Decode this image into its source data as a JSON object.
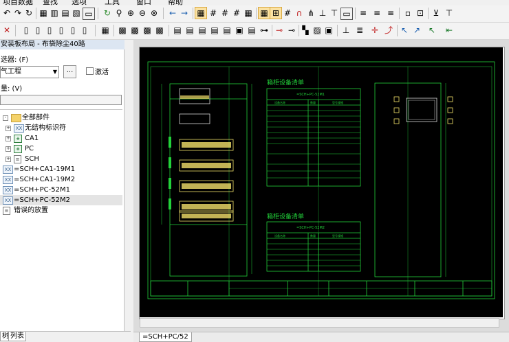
{
  "menu": [
    "项目数据",
    "查找",
    "选项",
    "工具",
    "窗口",
    "帮助"
  ],
  "toolbar1": [
    "undo-icon",
    "redo-icon",
    "refresh-icon",
    "view-1-icon",
    "view-2-icon",
    "view-3-icon",
    "view-4-icon",
    "window-icon",
    "rotate-icon",
    "zoom-search-icon",
    "zoom-in-icon",
    "zoom-out-icon",
    "zoom-all-icon",
    "back-icon",
    "forward-icon",
    "grid-icon",
    "hatch-1-icon",
    "hatch-2-icon",
    "hatch-3-icon",
    "grid-4-icon",
    "grid-5-icon",
    "hash-icon",
    "magnet-icon",
    "snap-icon",
    "snap-2-icon",
    "rect-icon",
    "lines-icon",
    "lines-2-icon",
    "dots-icon",
    "cart-icon",
    "bracket-icon"
  ],
  "panel": {
    "title": "安装板布局 - 布袋除尘40路",
    "filter_label": "选器: (F)",
    "combo_value": "气工程",
    "dots": "...",
    "activate_label": "激活",
    "search_label": "量: (V)"
  },
  "tree": [
    {
      "label": "全部部件",
      "icon": "folder",
      "expander": "-",
      "indent": 0
    },
    {
      "label": "无结构标识符",
      "icon": "xxx",
      "expander": "+",
      "indent": 1
    },
    {
      "label": "CA1",
      "icon": "plusbox",
      "expander": "+",
      "indent": 1
    },
    {
      "label": "PC",
      "icon": "plusbox",
      "expander": "+",
      "indent": 1
    },
    {
      "label": "SCH",
      "icon": "listbox",
      "expander": "+",
      "indent": 1
    },
    {
      "label": "=SCH+CA1-19M1",
      "icon": "xxx",
      "expander": "",
      "indent": 0
    },
    {
      "label": "=SCH+CA1-19M2",
      "icon": "xxx",
      "expander": "",
      "indent": 0
    },
    {
      "label": "=SCH+PC-52M1",
      "icon": "xxx",
      "expander": "",
      "indent": 0
    },
    {
      "label": "=SCH+PC-52M2",
      "icon": "xxx",
      "expander": "",
      "indent": 0,
      "selected": true
    },
    {
      "label": "错误的放置",
      "icon": "listbox",
      "expander": "",
      "indent": 0
    }
  ],
  "icon_glyphs": {
    "folder": "",
    "xxx": "XX",
    "plusbox": "+",
    "listbox": "≡"
  },
  "bottom_tabs": [
    "树",
    "列表"
  ],
  "doc_tab": "=SCH+PC/52",
  "drawing": {
    "table1_title": "箱柜设备清单",
    "table1_subtitle": "=SCH+PC-52M1",
    "table2_title": "箱柜设备清单",
    "table2_subtitle": "=SCH+PC-52M2",
    "col_headers": [
      "设备名称",
      "数量",
      "型号规格"
    ]
  },
  "colors": {
    "line": "#22d13a",
    "terminal": "#f2e06a",
    "canvas": "#000000"
  }
}
